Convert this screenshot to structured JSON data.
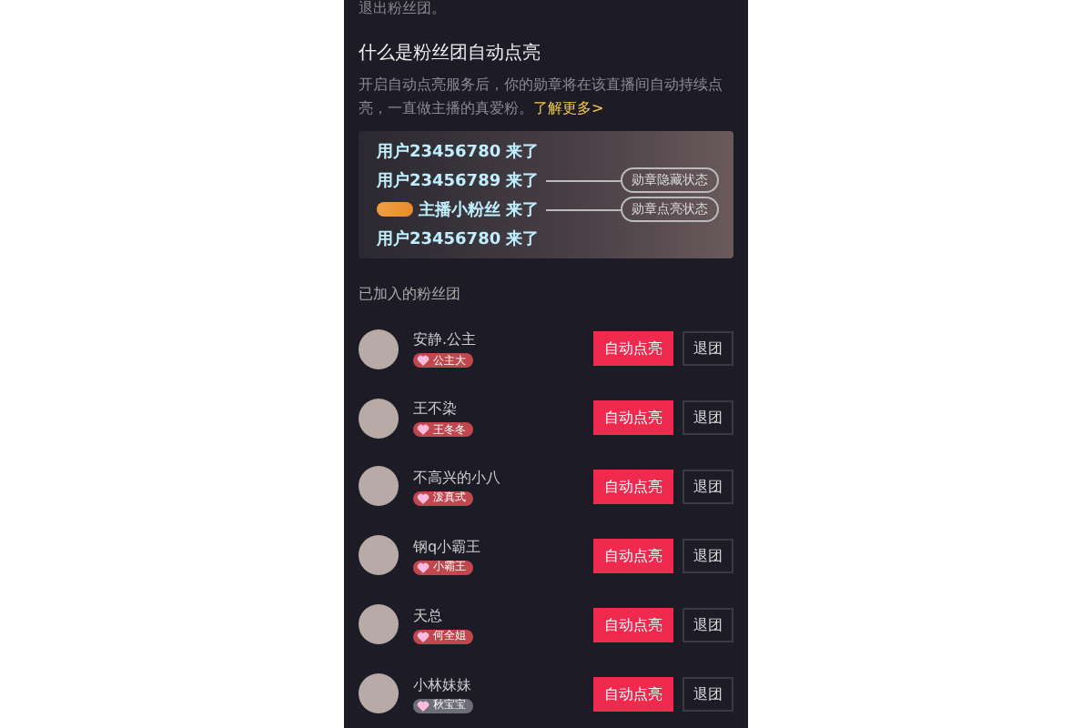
{
  "intro_tail": "退出粉丝团。",
  "section": {
    "title": "什么是粉丝团自动点亮",
    "description": "开启自动点亮服务后，你的勋章将在该直播间自动持续点亮，一直做主播的真爱粉。",
    "link": "了解更多>"
  },
  "demo": {
    "lines": [
      {
        "text": "用户23456780 来了",
        "badge": false
      },
      {
        "text": "用户23456789 来了",
        "badge": false,
        "callout": "勋章隐藏状态"
      },
      {
        "text": "主播小粉丝 来了",
        "badge": true,
        "callout": "勋章点亮状态"
      },
      {
        "text": "用户23456780 来了",
        "badge": false
      }
    ]
  },
  "joined_title": "已加入的粉丝团",
  "clubs": [
    {
      "name": "安静.公主",
      "badge": "公主大",
      "color": "#c0474e",
      "action": "自动点亮",
      "leave": "退团"
    },
    {
      "name": "王不染",
      "badge": "王冬冬",
      "color": "#c0474e",
      "action": "自动点亮",
      "leave": "退团"
    },
    {
      "name": "不高兴的小八",
      "badge": "泼真式",
      "color": "#c0474e",
      "action": "自动点亮",
      "leave": "退团"
    },
    {
      "name": "钢q小霸王",
      "badge": "小霸王",
      "color": "#c0474e",
      "action": "自动点亮",
      "leave": "退团"
    },
    {
      "name": "天总",
      "badge": "何全姐",
      "color": "#c0474e",
      "action": "自动点亮",
      "leave": "退团"
    },
    {
      "name": "小林妹妹",
      "badge": "秋宝宝",
      "color": "#6e6e78",
      "action": "自动点亮",
      "leave": "退团"
    }
  ]
}
